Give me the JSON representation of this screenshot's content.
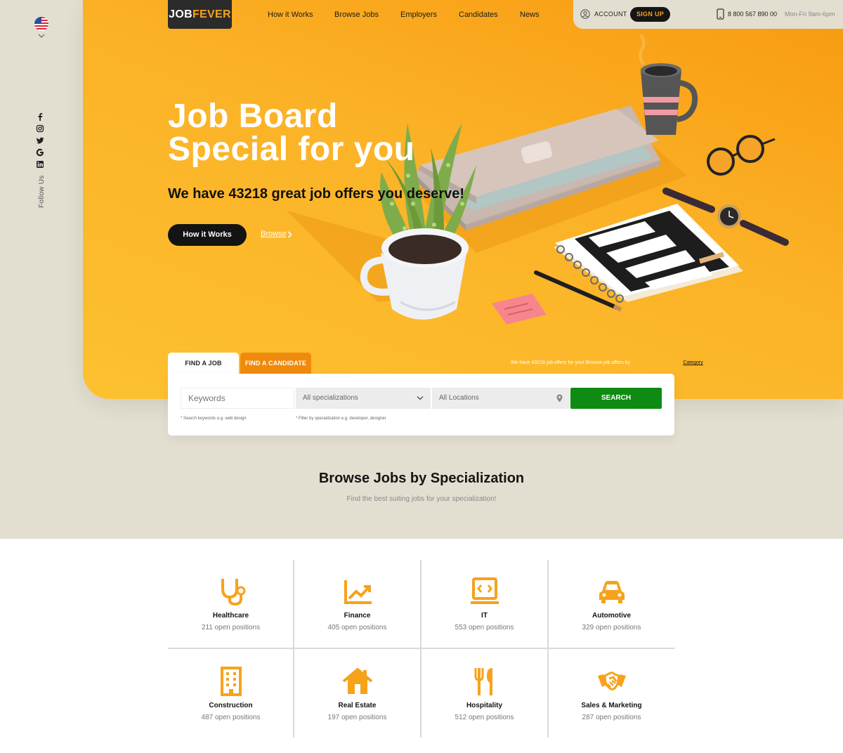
{
  "colors": {
    "accent": "#f7a21b",
    "hero_orange": "#f89a10",
    "hero_yellow": "#fdc12f",
    "search_green": "#0f8a12",
    "tab_orange": "#ef8a0c",
    "dark": "#141414",
    "beige": "#e2dfd0"
  },
  "sidebar": {
    "language_flag": "us-flag-icon",
    "social_icons": [
      "facebook-icon",
      "instagram-icon",
      "twitter-icon",
      "google-icon",
      "linkedin-icon"
    ],
    "follow_label": "Follow Us"
  },
  "header": {
    "logo_part1": "JOB",
    "logo_part2": "FEVER",
    "nav": [
      "How it Works",
      "Browse Jobs",
      "Employers",
      "Candidates",
      "News"
    ],
    "account_label": "ACCOUNT",
    "signup_label": "SIGN UP",
    "phone": "8 800 567 890 00",
    "hours": "Mon-Fri 9am-6pm"
  },
  "hero": {
    "title_line1": "Job Board",
    "title_line2": "Special for you",
    "subtitle": "We have 43218 great job offers you deserve!",
    "primary_button": "How it Works",
    "secondary_link": "Browse"
  },
  "search": {
    "tabs": [
      "FIND A JOB",
      "FIND A CANDIDATE"
    ],
    "offers_note": "We have 43218 job offers for you! Browse job offers by ",
    "offers_note_link": "Category",
    "keywords_placeholder": "Keywords",
    "specialization_value": "All specializations",
    "location_value": "All Locations",
    "search_button": "SEARCH",
    "keywords_hint": "* Search keywords e.g. web design",
    "specialization_hint": "* Filter by specialization e.g. developer, designer"
  },
  "browse": {
    "title": "Browse Jobs by Specialization",
    "subtitle": "Find the best suiting jobs for your specialization!",
    "categories": [
      {
        "name": "Healthcare",
        "count": "211 open positions",
        "icon": "stethoscope-icon"
      },
      {
        "name": "Finance",
        "count": "405 open positions",
        "icon": "chart-icon"
      },
      {
        "name": "IT",
        "count": "553 open positions",
        "icon": "laptop-code-icon"
      },
      {
        "name": "Automotive",
        "count": "329 open positions",
        "icon": "car-icon"
      },
      {
        "name": "Construction",
        "count": "487 open positions",
        "icon": "building-icon"
      },
      {
        "name": "Real Estate",
        "count": "197 open positions",
        "icon": "house-icon"
      },
      {
        "name": "Hospitality",
        "count": "512 open positions",
        "icon": "fork-knife-icon"
      },
      {
        "name": "Sales & Marketing",
        "count": "287 open positions",
        "icon": "handshake-icon"
      }
    ]
  }
}
